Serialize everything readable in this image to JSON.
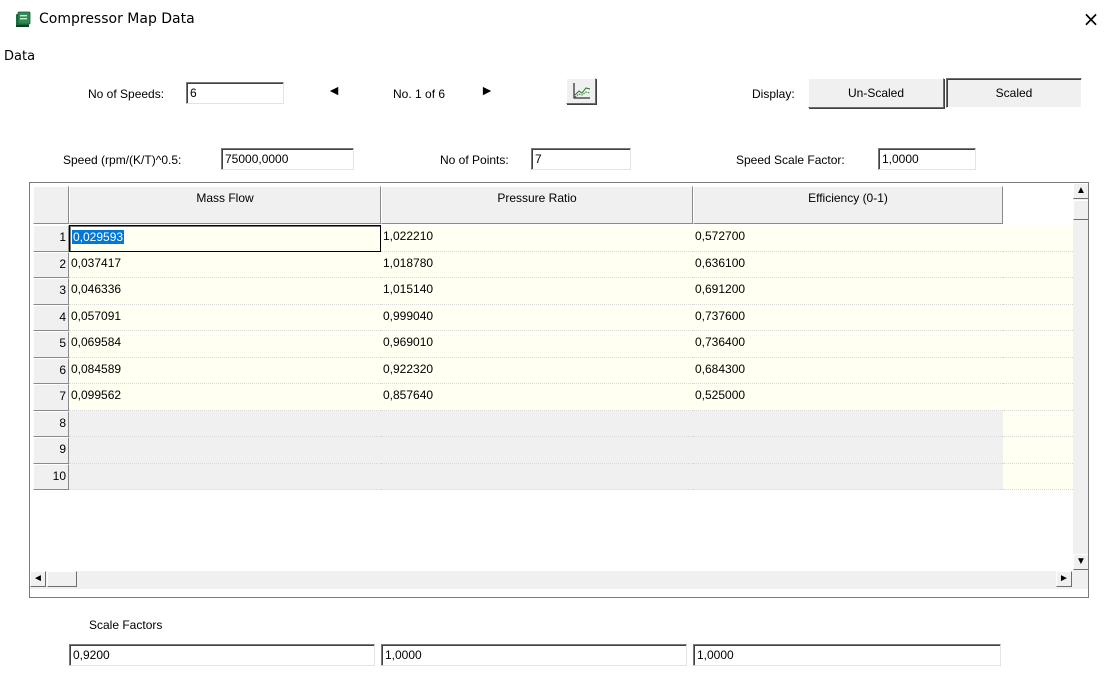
{
  "window": {
    "title": "Compressor Map Data",
    "close_glyph": "×",
    "icon": "app-book-icon"
  },
  "menu": {
    "items": [
      "Data"
    ]
  },
  "controls": {
    "no_of_speeds_label": "No of Speeds:",
    "no_of_speeds_value": "6",
    "prev_glyph": "◄",
    "page_indicator": "No. 1 of 6",
    "next_glyph": "►",
    "chart_icon": "line-chart-icon",
    "display_label": "Display:",
    "unscaled_label": "Un-Scaled",
    "scaled_label": "Scaled",
    "selected_display": "Scaled",
    "speed_label": "Speed (rpm/(K/T)^0.5:",
    "speed_value": "75000,0000",
    "no_of_points_label": "No of Points:",
    "no_of_points_value": "7",
    "speed_scale_factor_label": "Speed Scale Factor:",
    "speed_scale_factor_value": "1,0000"
  },
  "table": {
    "columns": [
      "Mass Flow",
      "Pressure Ratio",
      "Efficiency (0-1)"
    ],
    "row_numbers": [
      "1",
      "2",
      "3",
      "4",
      "5",
      "6",
      "7",
      "8",
      "9",
      "10"
    ],
    "rows": [
      [
        "0,029593",
        "1,022210",
        "0,572700"
      ],
      [
        "0,037417",
        "1,018780",
        "0,636100"
      ],
      [
        "0,046336",
        "1,015140",
        "0,691200"
      ],
      [
        "0,057091",
        "0,999040",
        "0,737600"
      ],
      [
        "0,069584",
        "0,969010",
        "0,736400"
      ],
      [
        "0,084589",
        "0,922320",
        "0,684300"
      ],
      [
        "0,099562",
        "0,857640",
        "0,525000"
      ],
      [
        "",
        "",
        ""
      ],
      [
        "",
        "",
        ""
      ],
      [
        "",
        "",
        ""
      ]
    ],
    "selected_cell": "0,029593",
    "scroll_up_glyph": "▲",
    "scroll_down_glyph": "▼",
    "scroll_left_glyph": "◄",
    "scroll_right_glyph": "►"
  },
  "scale_factors": {
    "label": "Scale Factors",
    "values": [
      "0,9200",
      "1,0000",
      "1,0000"
    ]
  },
  "colors": {
    "data_cell_bg": "#fffff2",
    "empty_cell_bg": "#f0f0f0",
    "selection": "#0078d7"
  }
}
